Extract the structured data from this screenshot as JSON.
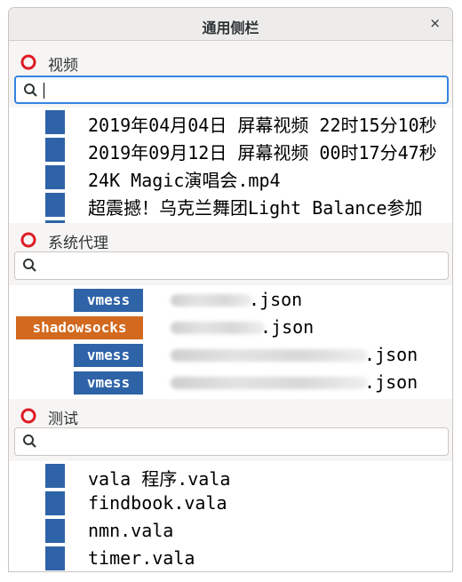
{
  "window": {
    "title": "通用侧栏",
    "close_glyph": "×"
  },
  "sections": [
    {
      "title": "视频",
      "icon": "ring-red-icon",
      "search": {
        "placeholder": "",
        "value": ""
      },
      "items": [
        "2019年04月04日 屏幕视频 22时15分10秒",
        "2019年09月12日 屏幕视频 00时17分47秒",
        "24K Magic演唱会.mp4",
        "超震撼！乌克兰舞团Light Balance参加"
      ]
    },
    {
      "title": "系统代理",
      "icon": "ring-red-icon",
      "search": {
        "placeholder": "",
        "value": ""
      },
      "items": [
        {
          "type": "vmess",
          "suffix": ".json"
        },
        {
          "type": "shadowsocks",
          "suffix": ".json"
        },
        {
          "type": "vmess",
          "suffix": ".json"
        },
        {
          "type": "vmess",
          "suffix": ".json"
        }
      ]
    },
    {
      "title": "测试",
      "icon": "ring-red-icon",
      "search": {
        "placeholder": "",
        "value": ""
      },
      "items": [
        "vala 程序.vala",
        "findbook.vala",
        "nmn.vala",
        "timer.vala"
      ]
    }
  ],
  "colors": {
    "accent": "#3584e4",
    "item_box": "#2e63a8",
    "vmess": "#2e63a8",
    "shadowsocks": "#d2691e",
    "ring": "#e01b24"
  }
}
